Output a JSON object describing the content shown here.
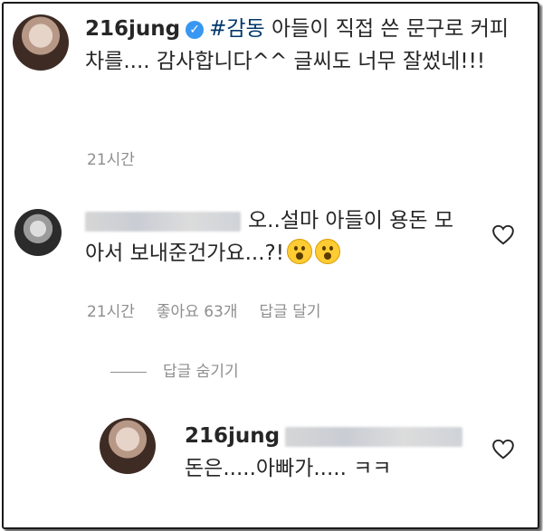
{
  "post": {
    "username": "216jung",
    "hashtag": "#감동",
    "caption": " 아들이 직접 쓴 문구로 커피차를.... 감사합니다^^ 글씨도 너무 잘썼네!!!",
    "time": "21시간"
  },
  "comment": {
    "text": "오..설마 아들이 용돈 모아서 보내준건가요...?!",
    "time": "21시간",
    "likes": "좋아요 63개",
    "reply_label": "답글 달기"
  },
  "hide_replies_label": "답글 숨기기",
  "reply": {
    "username": "216jung",
    "text": "돈은.....아빠가..... ㅋㅋ"
  },
  "icons": {
    "verified": "verified-badge-icon",
    "like": "heart-outline-icon",
    "emoji": "astonished-face-emoji"
  },
  "colors": {
    "text": "#262626",
    "meta": "#8e8e8e",
    "verified": "#3897f0",
    "hashtag": "#00376b"
  }
}
